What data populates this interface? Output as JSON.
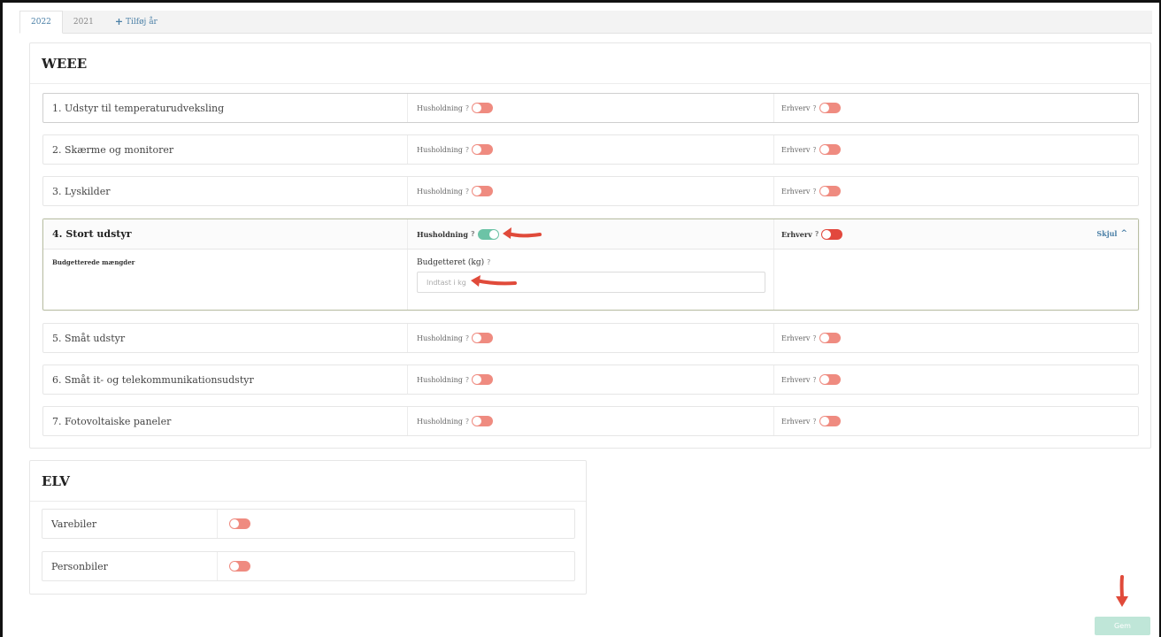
{
  "tabs": [
    {
      "label": "2022",
      "active": true
    },
    {
      "label": "2021",
      "active": false
    }
  ],
  "add_year": "Tilføj år",
  "weee": {
    "title": "WEEE",
    "household_label": "Husholdning",
    "business_label": "Erhverv",
    "rows": [
      {
        "name": "1. Udstyr til temperaturudveksling",
        "household_on": false,
        "business_on": false
      },
      {
        "name": "2. Skærme og monitorer",
        "household_on": false,
        "business_on": false
      },
      {
        "name": "3. Lyskilder",
        "household_on": false,
        "business_on": false
      },
      {
        "name": "4. Stort udstyr",
        "household_on": true,
        "business_on": false
      },
      {
        "name": "5. Småt udstyr",
        "household_on": false,
        "business_on": false
      },
      {
        "name": "6. Småt it- og telekommunikationsudstyr",
        "household_on": false,
        "business_on": false
      },
      {
        "name": "7. Fotovoltaiske paneler",
        "household_on": false,
        "business_on": false
      }
    ],
    "expanded": {
      "hide_label": "Skjul",
      "budget_section_label": "Budgetterede mængder",
      "budget_field_label": "Budgetteret (kg)",
      "budget_placeholder": "Indtast i kg"
    }
  },
  "elv": {
    "title": "ELV",
    "rows": [
      {
        "name": "Varebiler",
        "on": false
      },
      {
        "name": "Personbiler",
        "on": false
      }
    ]
  },
  "save_label": "Gem",
  "colors": {
    "toggle_off": "#ef8b80",
    "toggle_on": "#6cc3a6",
    "accent": "#4a7fa6",
    "save_disabled": "#bfe6d8",
    "annotation_arrow": "#e04a3a"
  }
}
